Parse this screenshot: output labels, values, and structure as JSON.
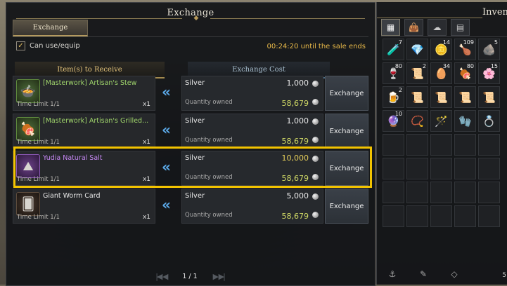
{
  "window": {
    "title": "Exchange"
  },
  "tabs": [
    {
      "label": "Exchange",
      "active": true
    }
  ],
  "filter": {
    "label": "Can use/equip",
    "checked": true
  },
  "sale_timer": "00:24:20 until the sale ends",
  "columns": {
    "receive": "Item(s) to Receive",
    "cost": "Exchange Cost"
  },
  "rows": [
    {
      "name": "[Masterwork] Artisan's Stew",
      "grade": "green",
      "icon": "stew-icon",
      "time_limit": "Time Limit 1/1",
      "quantity": "x1",
      "currency": "Silver",
      "cost": "1,000",
      "owned_label": "Quantity owned",
      "owned": "58,679",
      "button": "Exchange"
    },
    {
      "name": "[Masterwork] Artisan's Grilled...",
      "grade": "green",
      "icon": "grilled-food-icon",
      "time_limit": "Time Limit 1/1",
      "quantity": "x1",
      "currency": "Silver",
      "cost": "1,000",
      "owned_label": "Quantity owned",
      "owned": "58,679",
      "button": "Exchange"
    },
    {
      "name": "Yudia Natural Salt",
      "grade": "purple",
      "icon": "salt-icon",
      "time_limit": "Time Limit 1/1",
      "quantity": "x1",
      "currency": "Silver",
      "cost": "10,000",
      "owned_label": "Quantity owned",
      "owned": "58,679",
      "button": "Exchange",
      "selected": true
    },
    {
      "name": "Giant Worm Card",
      "grade": "white",
      "icon": "card-icon",
      "time_limit": "Time Limit 1/1",
      "quantity": "x1",
      "currency": "Silver",
      "cost": "5,000",
      "owned_label": "Quantity owned",
      "owned": "58,679",
      "button": "Exchange"
    }
  ],
  "pager": {
    "text": "1 / 1"
  },
  "inventory": {
    "title": "Invent",
    "tabs": [
      "grid-icon",
      "bag-icon",
      "cloud-icon",
      "book-icon"
    ],
    "slots": [
      {
        "icon": "potion-icon",
        "count": "7"
      },
      {
        "icon": "crystal-icon",
        "count": ""
      },
      {
        "icon": "coin-icon",
        "count": "14"
      },
      {
        "icon": "food-icon",
        "count": "109"
      },
      {
        "icon": "ore-icon",
        "count": "5"
      },
      {
        "icon": "potion-red-icon",
        "count": "80"
      },
      {
        "icon": "scroll-icon",
        "count": "2"
      },
      {
        "icon": "seed-icon",
        "count": "34"
      },
      {
        "icon": "meat-icon",
        "count": "80"
      },
      {
        "icon": "flower-icon",
        "count": "15"
      },
      {
        "icon": "mug-icon",
        "count": "2"
      },
      {
        "icon": "scroll-icon",
        "count": ""
      },
      {
        "icon": "scroll-icon",
        "count": ""
      },
      {
        "icon": "scroll-icon",
        "count": ""
      },
      {
        "icon": "scroll-icon",
        "count": ""
      },
      {
        "icon": "rune-icon",
        "count": "10"
      },
      {
        "icon": "amulet-icon",
        "count": ""
      },
      {
        "icon": "staff-icon",
        "count": ""
      },
      {
        "icon": "gloves-icon",
        "count": ""
      },
      {
        "icon": "ring-icon",
        "count": ""
      }
    ],
    "empty_slots": 20,
    "bottom_tools": [
      "anchor-icon",
      "tool-icon",
      "gem-icon"
    ],
    "bottom_number": "5"
  }
}
